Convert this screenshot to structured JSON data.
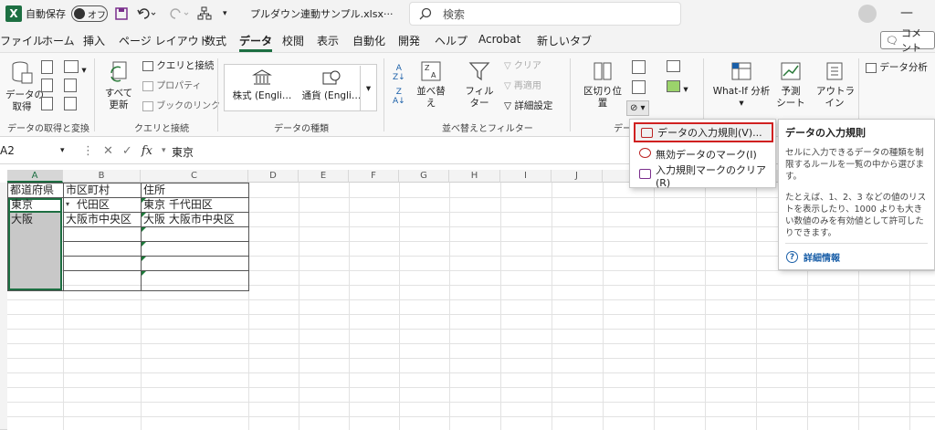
{
  "titlebar": {
    "app_icon": "X",
    "autosave_label": "自動保存",
    "autosave_state": "オフ",
    "filename": "プルダウン連動サンプル.xlsx",
    "filename_more": "···",
    "search_placeholder": "検索"
  },
  "menu": {
    "tabs": [
      "ファイル",
      "ホーム",
      "挿入",
      "ページ レイアウト",
      "数式",
      "データ",
      "校閲",
      "表示",
      "自動化",
      "開発",
      "ヘルプ",
      "Acrobat",
      "新しいタブ"
    ],
    "active": "データ",
    "comment_label": "コメント"
  },
  "ribbon": {
    "get_data": "データの\n取得",
    "query_conn": "クエリと接続",
    "properties": "プロパティ",
    "book_links": "ブックのリンク",
    "refresh_all": "すべて\n更新",
    "stocks": "株式 (Engli…",
    "currency": "通貨 (Engli…",
    "sort": "並べ替え",
    "filter": "フィルター",
    "clear": "クリア",
    "reapply": "再適用",
    "advanced": "詳細設定",
    "text_to_columns": "区切り位置",
    "whatif": "What-If 分析",
    "forecast_sheet": "予測\nシート",
    "outline": "アウトラ\nイン",
    "data_analysis": "データ分析",
    "groups": {
      "get_transform": "データの取得と変換",
      "queries_connections": "クエリと接続",
      "data_types": "データの種類",
      "sort_filter": "並べ替えとフィルター",
      "data_tools": "デー"
    }
  },
  "formula_bar": {
    "cell_ref": "A2",
    "value": "東京"
  },
  "grid": {
    "columns": [
      "A",
      "B",
      "C",
      "D",
      "E",
      "F",
      "G",
      "H",
      "I",
      "J"
    ],
    "header_row": [
      "都道府県",
      "市区町村",
      "住所"
    ],
    "rows": [
      [
        "東京",
        "代田区",
        "東京 千代田区"
      ],
      [
        "大阪",
        "大阪市中央区",
        "大阪 大阪市中央区"
      ]
    ]
  },
  "dv_menu": {
    "items": [
      "データの入力規則(V)...",
      "無効データのマーク(I)",
      "入力規則マークのクリア(R)"
    ]
  },
  "tooltip": {
    "title": "データの入力規則",
    "body1": "セルに入力できるデータの種類を制限するルールを一覧の中から選びます。",
    "body2": "たとえば、1、2、3 などの値のリストを表示したり、1000 よりも大きい数値のみを有効値として許可したりできます。",
    "link": "詳細情報"
  },
  "colors": {
    "excel_green": "#1d6f42",
    "highlight_red": "#d02020",
    "link_blue": "#1a5fa8"
  }
}
